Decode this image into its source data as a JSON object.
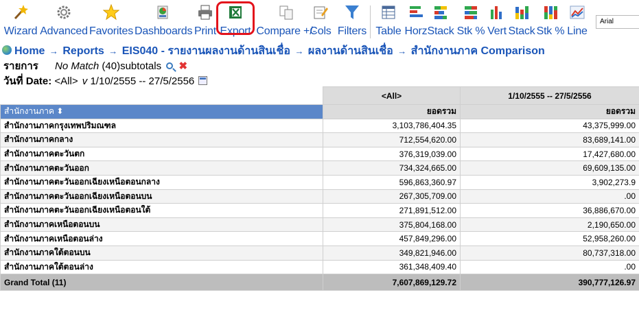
{
  "toolbar": {
    "items": [
      {
        "label": "Wizard",
        "icon": "wand-icon"
      },
      {
        "label": "Advanced",
        "icon": "gear-icon"
      },
      {
        "label": "Favorites",
        "icon": "star-icon"
      },
      {
        "label": "Dashboards",
        "icon": "dashboard-icon"
      },
      {
        "label": "Print",
        "icon": "printer-icon"
      },
      {
        "label": "Export",
        "icon": "excel-icon"
      },
      {
        "label": "Compare +/-",
        "icon": "compare-icon"
      },
      {
        "label": "Cols",
        "icon": "columns-icon"
      },
      {
        "label": "Filters",
        "icon": "filter-icon"
      },
      {
        "label": "Table",
        "icon": "table-icon"
      },
      {
        "label": "Horz",
        "icon": "horizontal-bar-chart-icon"
      },
      {
        "label": "Stack",
        "icon": "stacked-bar-chart-icon"
      },
      {
        "label": "Stk %",
        "icon": "stacked-percent-chart-icon"
      },
      {
        "label": "Vert",
        "icon": "vertical-bar-chart-icon"
      },
      {
        "label": "Stack",
        "icon": "vertical-stack-chart-icon"
      },
      {
        "label": "Stk %",
        "icon": "vertical-stack-percent-chart-icon"
      },
      {
        "label": "Line",
        "icon": "line-chart-icon"
      }
    ],
    "font_value": "Arial",
    "highlight_color": "#e3121b",
    "label_color": "#1a55b8"
  },
  "breadcrumb": {
    "home": "Home",
    "reports": "Reports",
    "report": "EIS040 - รายงานผลงานด้านสินเชื่อ",
    "sub": "ผลงานด้านสินเชื่อ",
    "current": "สำนักงานภาค Comparison",
    "sep": "→"
  },
  "filters": {
    "item_label": "รายการ",
    "item_value": "No Match",
    "item_count": "(40)subtotals",
    "date_label": "วันที่ Date:",
    "date_all": "<All>",
    "date_check": "v",
    "date_range": "1/10/2555 -- 27/5/2556"
  },
  "table": {
    "group_headers": [
      "<All>",
      "1/10/2555 -- 27/5/2556"
    ],
    "row_header": "สำนักงานภาค",
    "measure": "ยอดรวม",
    "rows": [
      {
        "name": "สำนักงานภาคกรุงเทพปริมณฑล",
        "all": "3,103,786,404.35",
        "period": "43,375,999.00"
      },
      {
        "name": "สำนักงานภาคกลาง",
        "all": "712,554,620.00",
        "period": "83,689,141.00"
      },
      {
        "name": "สำนักงานภาคตะวันตก",
        "all": "376,319,039.00",
        "period": "17,427,680.00"
      },
      {
        "name": "สำนักงานภาคตะวันออก",
        "all": "734,324,665.00",
        "period": "69,609,135.00"
      },
      {
        "name": "สำนักงานภาคตะวันออกเฉียงเหนือตอนกลาง",
        "all": "596,863,360.97",
        "period": "3,902,273.9"
      },
      {
        "name": "สำนักงานภาคตะวันออกเฉียงเหนือตอนบน",
        "all": "267,305,709.00",
        "period": ".00"
      },
      {
        "name": "สำนักงานภาคตะวันออกเฉียงเหนือตอนใต้",
        "all": "271,891,512.00",
        "period": "36,886,670.00"
      },
      {
        "name": "สำนักงานภาคเหนือตอนบน",
        "all": "375,804,168.00",
        "period": "2,190,650.00"
      },
      {
        "name": "สำนักงานภาคเหนือตอนล่าง",
        "all": "457,849,296.00",
        "period": "52,958,260.00"
      },
      {
        "name": "สำนักงานภาคใต้ตอนบน",
        "all": "349,821,946.00",
        "period": "80,737,318.00"
      },
      {
        "name": "สำนักงานภาคใต้ตอนล่าง",
        "all": "361,348,409.40",
        "period": ".00"
      }
    ],
    "total_label": "Grand Total (11)",
    "total_all": "7,607,869,129.72",
    "total_period": "390,777,126.97"
  }
}
